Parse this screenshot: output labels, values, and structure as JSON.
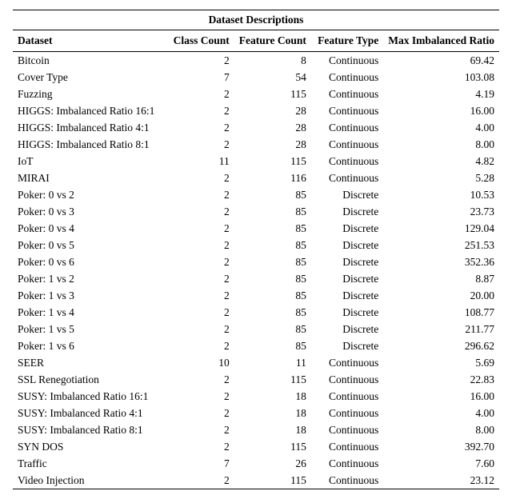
{
  "chart_data": {
    "type": "table",
    "title": "Dataset Descriptions",
    "columns": [
      "Dataset",
      "Class Count",
      "Feature Count",
      "Feature Type",
      "Max Imbalanced Ratio"
    ],
    "rows": [
      [
        "Bitcoin",
        2,
        8,
        "Continuous",
        69.42
      ],
      [
        "Cover Type",
        7,
        54,
        "Continuous",
        103.08
      ],
      [
        "Fuzzing",
        2,
        115,
        "Continuous",
        4.19
      ],
      [
        "HIGGS: Imbalanced Ratio 16:1",
        2,
        28,
        "Continuous",
        16.0
      ],
      [
        "HIGGS: Imbalanced Ratio 4:1",
        2,
        28,
        "Continuous",
        4.0
      ],
      [
        "HIGGS: Imbalanced Ratio 8:1",
        2,
        28,
        "Continuous",
        8.0
      ],
      [
        "IoT",
        11,
        115,
        "Continuous",
        4.82
      ],
      [
        "MIRAI",
        2,
        116,
        "Continuous",
        5.28
      ],
      [
        "Poker: 0 vs 2",
        2,
        85,
        "Discrete",
        10.53
      ],
      [
        "Poker: 0 vs 3",
        2,
        85,
        "Discrete",
        23.73
      ],
      [
        "Poker: 0 vs 4",
        2,
        85,
        "Discrete",
        129.04
      ],
      [
        "Poker: 0 vs 5",
        2,
        85,
        "Discrete",
        251.53
      ],
      [
        "Poker: 0 vs 6",
        2,
        85,
        "Discrete",
        352.36
      ],
      [
        "Poker: 1 vs 2",
        2,
        85,
        "Discrete",
        8.87
      ],
      [
        "Poker: 1 vs 3",
        2,
        85,
        "Discrete",
        20.0
      ],
      [
        "Poker: 1 vs 4",
        2,
        85,
        "Discrete",
        108.77
      ],
      [
        "Poker: 1 vs 5",
        2,
        85,
        "Discrete",
        211.77
      ],
      [
        "Poker: 1 vs 6",
        2,
        85,
        "Discrete",
        296.62
      ],
      [
        "SEER",
        10,
        11,
        "Continuous",
        5.69
      ],
      [
        "SSL Renegotiation",
        2,
        115,
        "Continuous",
        22.83
      ],
      [
        "SUSY: Imbalanced Ratio 16:1",
        2,
        18,
        "Continuous",
        16.0
      ],
      [
        "SUSY: Imbalanced Ratio 4:1",
        2,
        18,
        "Continuous",
        4.0
      ],
      [
        "SUSY: Imbalanced Ratio 8:1",
        2,
        18,
        "Continuous",
        8.0
      ],
      [
        "SYN DOS",
        2,
        115,
        "Continuous",
        392.7
      ],
      [
        "Traffic",
        7,
        26,
        "Continuous",
        7.6
      ],
      [
        "Video Injection",
        2,
        115,
        "Continuous",
        23.12
      ]
    ]
  },
  "title": "Dataset Descriptions",
  "headers": {
    "c0": "Dataset",
    "c1": "Class Count",
    "c2": "Feature Count",
    "c3": "Feature Type",
    "c4": "Max Imbalanced Ratio"
  },
  "rows": [
    {
      "c0": "Bitcoin",
      "c1": "2",
      "c2": "8",
      "c3": "Continuous",
      "c4": "69.42"
    },
    {
      "c0": "Cover Type",
      "c1": "7",
      "c2": "54",
      "c3": "Continuous",
      "c4": "103.08"
    },
    {
      "c0": "Fuzzing",
      "c1": "2",
      "c2": "115",
      "c3": "Continuous",
      "c4": "4.19"
    },
    {
      "c0": "HIGGS: Imbalanced Ratio 16:1",
      "c1": "2",
      "c2": "28",
      "c3": "Continuous",
      "c4": "16.00"
    },
    {
      "c0": "HIGGS: Imbalanced Ratio 4:1",
      "c1": "2",
      "c2": "28",
      "c3": "Continuous",
      "c4": "4.00"
    },
    {
      "c0": "HIGGS: Imbalanced Ratio 8:1",
      "c1": "2",
      "c2": "28",
      "c3": "Continuous",
      "c4": "8.00"
    },
    {
      "c0": "IoT",
      "c1": "11",
      "c2": "115",
      "c3": "Continuous",
      "c4": "4.82"
    },
    {
      "c0": "MIRAI",
      "c1": "2",
      "c2": "116",
      "c3": "Continuous",
      "c4": "5.28"
    },
    {
      "c0": "Poker: 0 vs 2",
      "c1": "2",
      "c2": "85",
      "c3": "Discrete",
      "c4": "10.53"
    },
    {
      "c0": "Poker: 0 vs 3",
      "c1": "2",
      "c2": "85",
      "c3": "Discrete",
      "c4": "23.73"
    },
    {
      "c0": "Poker: 0 vs 4",
      "c1": "2",
      "c2": "85",
      "c3": "Discrete",
      "c4": "129.04"
    },
    {
      "c0": "Poker: 0 vs 5",
      "c1": "2",
      "c2": "85",
      "c3": "Discrete",
      "c4": "251.53"
    },
    {
      "c0": "Poker: 0 vs 6",
      "c1": "2",
      "c2": "85",
      "c3": "Discrete",
      "c4": "352.36"
    },
    {
      "c0": "Poker: 1 vs 2",
      "c1": "2",
      "c2": "85",
      "c3": "Discrete",
      "c4": "8.87"
    },
    {
      "c0": "Poker: 1 vs 3",
      "c1": "2",
      "c2": "85",
      "c3": "Discrete",
      "c4": "20.00"
    },
    {
      "c0": "Poker: 1 vs 4",
      "c1": "2",
      "c2": "85",
      "c3": "Discrete",
      "c4": "108.77"
    },
    {
      "c0": "Poker: 1 vs 5",
      "c1": "2",
      "c2": "85",
      "c3": "Discrete",
      "c4": "211.77"
    },
    {
      "c0": "Poker: 1 vs 6",
      "c1": "2",
      "c2": "85",
      "c3": "Discrete",
      "c4": "296.62"
    },
    {
      "c0": "SEER",
      "c1": "10",
      "c2": "11",
      "c3": "Continuous",
      "c4": "5.69"
    },
    {
      "c0": "SSL Renegotiation",
      "c1": "2",
      "c2": "115",
      "c3": "Continuous",
      "c4": "22.83"
    },
    {
      "c0": "SUSY: Imbalanced Ratio 16:1",
      "c1": "2",
      "c2": "18",
      "c3": "Continuous",
      "c4": "16.00"
    },
    {
      "c0": "SUSY: Imbalanced Ratio 4:1",
      "c1": "2",
      "c2": "18",
      "c3": "Continuous",
      "c4": "4.00"
    },
    {
      "c0": "SUSY: Imbalanced Ratio 8:1",
      "c1": "2",
      "c2": "18",
      "c3": "Continuous",
      "c4": "8.00"
    },
    {
      "c0": "SYN DOS",
      "c1": "2",
      "c2": "115",
      "c3": "Continuous",
      "c4": "392.70"
    },
    {
      "c0": "Traffic",
      "c1": "7",
      "c2": "26",
      "c3": "Continuous",
      "c4": "7.60"
    },
    {
      "c0": "Video Injection",
      "c1": "2",
      "c2": "115",
      "c3": "Continuous",
      "c4": "23.12"
    }
  ]
}
